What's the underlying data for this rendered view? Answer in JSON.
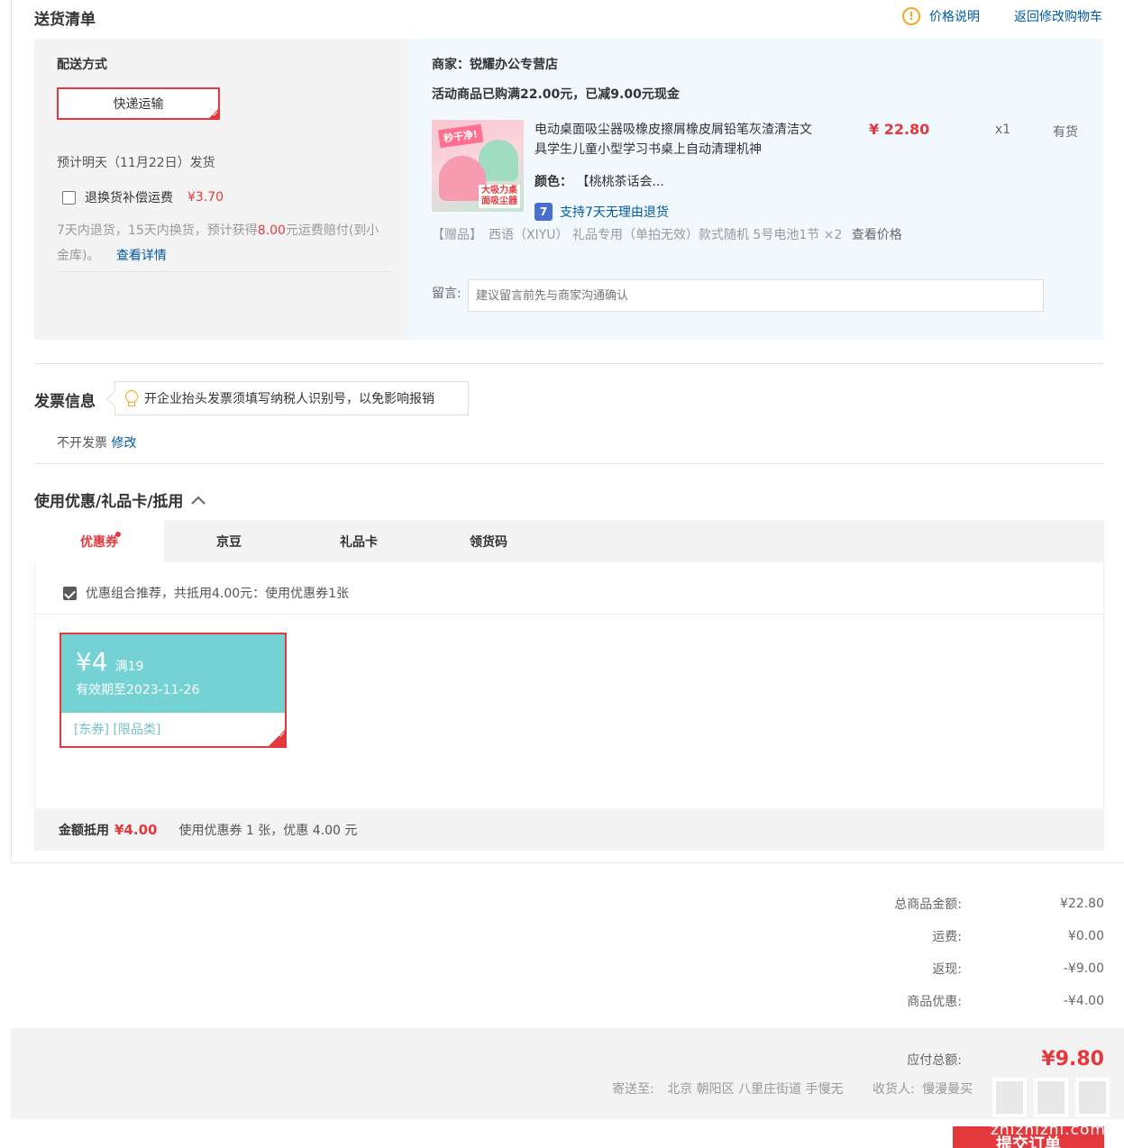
{
  "delivery": {
    "title": "送货清单",
    "price_note": "价格说明",
    "back_to_cart": "返回修改购物车",
    "ship_method_label": "配送方式",
    "ship_method_value": "快递运输",
    "estimate": "预计明天（11月22日）发货",
    "return_insurance_label": "退换货补偿运费",
    "return_insurance_price": "¥3.70",
    "return_desc_1": "7天内退货，15天内换货，预计获得",
    "return_desc_amount": "8.00",
    "return_desc_2": "元运费赔付(到小",
    "return_desc_3": "金库)。",
    "view_details": "查看详情",
    "seller": "商家：锐耀办公专营店",
    "promo": "活动商品已购满22.00元，已减9.00元现金",
    "product_name": "电动桌面吸尘器吸橡皮擦屑橡皮屑铅笔灰渣清洁文具学生儿童小型学习书桌上自动清理机神",
    "product_image_banner": "秒干净!",
    "product_image_tag": "大吸力桌面吸尘器",
    "product_price": "¥ 22.80",
    "product_qty": "x1",
    "product_stock": "有货",
    "color_label": "颜色：",
    "color_value": "【桃桃茶话会...",
    "return_badge": "支持7天无理由退货",
    "gift": "【赠品】　西语（XIYU） 礼品专用（单拍无效）款式随机 5号电池1节 ×2",
    "view_price": "查看价格",
    "memo_label": "留言:",
    "memo_placeholder": "建议留言前先与商家沟通确认"
  },
  "invoice": {
    "title": "发票信息",
    "tip": "开企业抬头发票须填写纳税人识别号，以免影响报销",
    "value": "不开发票",
    "edit": "修改"
  },
  "coupons": {
    "title": "使用优惠/礼品卡/抵用",
    "tabs": [
      {
        "label": "优惠券"
      },
      {
        "label": "京豆"
      },
      {
        "label": "礼品卡"
      },
      {
        "label": "领货码"
      }
    ],
    "recommend": "优惠组合推荐，共抵用4.00元：使用优惠券1张",
    "coupon_amount": "¥4",
    "coupon_condition": "满19",
    "coupon_valid": "有效期至2023-11-26",
    "coupon_tags": "[东券]  [限品类]",
    "amount_label": "金额抵用",
    "amount_value": "¥4.00",
    "amount_desc": "使用优惠券 1 张，优惠 4.00 元"
  },
  "totals": {
    "rows": [
      {
        "label": "总商品金额:",
        "value": "¥22.80"
      },
      {
        "label": "运费:",
        "value": "¥0.00"
      },
      {
        "label": "返现:",
        "value": "-¥9.00"
      },
      {
        "label": "商品优惠:",
        "value": "-¥4.00"
      }
    ],
    "pay_label": "应付总额:",
    "pay_value": "¥9.80",
    "ship_to_label": "寄送至:",
    "ship_to_value": "北京 朝阳区 八里庄街道 手慢无",
    "receiver_label": "收货人:",
    "receiver_value": "慢漫曼买",
    "submit": "提交订单"
  },
  "watermark": "zhizhizhi.com",
  "colors": {
    "accent": "#e4393c",
    "link": "#005aa0",
    "coupon": "#74d2d4"
  }
}
